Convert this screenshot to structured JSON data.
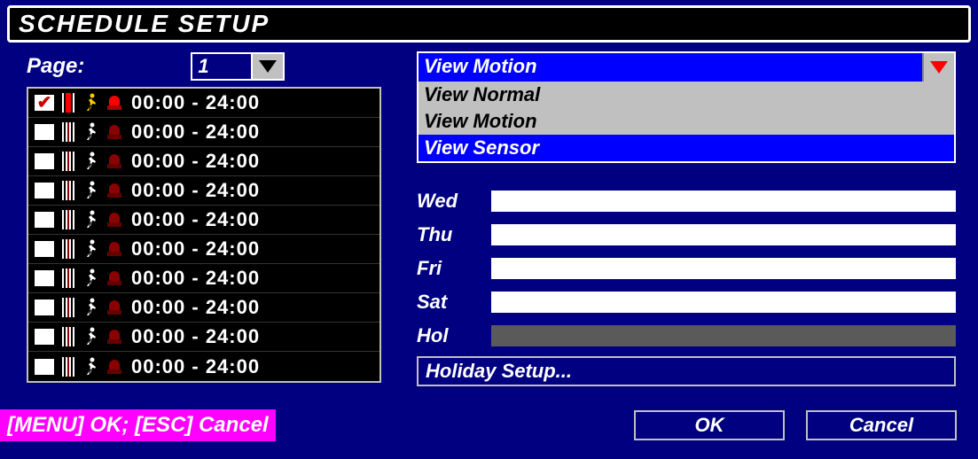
{
  "title": "SCHEDULE SETUP",
  "page": {
    "label": "Page:",
    "value": "1"
  },
  "schedule_rows": [
    {
      "checked": true,
      "film_active": true,
      "walker_color": "#ffcc00",
      "siren": "red",
      "time": "00:00 - 24:00"
    },
    {
      "checked": false,
      "film_active": false,
      "walker_color": "#ffffff",
      "siren": "dark",
      "time": "00:00 - 24:00"
    },
    {
      "checked": false,
      "film_active": false,
      "walker_color": "#ffffff",
      "siren": "dark",
      "time": "00:00 - 24:00"
    },
    {
      "checked": false,
      "film_active": false,
      "walker_color": "#ffffff",
      "siren": "dark",
      "time": "00:00 - 24:00"
    },
    {
      "checked": false,
      "film_active": false,
      "walker_color": "#ffffff",
      "siren": "dark",
      "time": "00:00 - 24:00"
    },
    {
      "checked": false,
      "film_active": false,
      "walker_color": "#ffffff",
      "siren": "dark",
      "time": "00:00 - 24:00"
    },
    {
      "checked": false,
      "film_active": false,
      "walker_color": "#ffffff",
      "siren": "dark",
      "time": "00:00 - 24:00"
    },
    {
      "checked": false,
      "film_active": false,
      "walker_color": "#ffffff",
      "siren": "dark",
      "time": "00:00 - 24:00"
    },
    {
      "checked": false,
      "film_active": false,
      "walker_color": "#ffffff",
      "siren": "dark",
      "time": "00:00 - 24:00"
    },
    {
      "checked": false,
      "film_active": false,
      "walker_color": "#ffffff",
      "siren": "dark",
      "time": "00:00 - 24:00"
    }
  ],
  "view": {
    "selected": "View Motion",
    "options": [
      "View Normal",
      "View Motion",
      "View Sensor"
    ],
    "highlight_index": 2
  },
  "days": [
    {
      "label": "Wed",
      "bar": "white"
    },
    {
      "label": "Thu",
      "bar": "white"
    },
    {
      "label": "Fri",
      "bar": "white"
    },
    {
      "label": "Sat",
      "bar": "white"
    },
    {
      "label": "Hol",
      "bar": "gray"
    }
  ],
  "holiday_button": "Holiday Setup...",
  "hint": "[MENU] OK; [ESC] Cancel",
  "buttons": {
    "ok": "OK",
    "cancel": "Cancel"
  }
}
